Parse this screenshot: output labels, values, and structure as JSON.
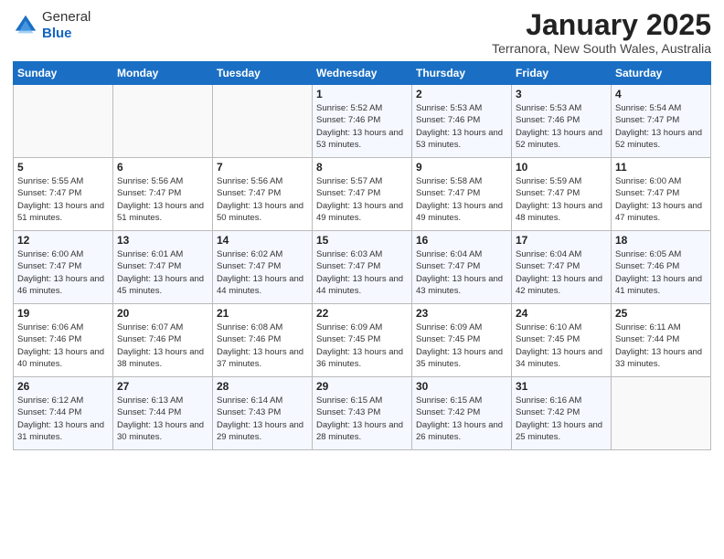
{
  "logo": {
    "general": "General",
    "blue": "Blue"
  },
  "header": {
    "title": "January 2025",
    "location": "Terranora, New South Wales, Australia"
  },
  "days_of_week": [
    "Sunday",
    "Monday",
    "Tuesday",
    "Wednesday",
    "Thursday",
    "Friday",
    "Saturday"
  ],
  "weeks": [
    [
      {
        "day": "",
        "info": ""
      },
      {
        "day": "",
        "info": ""
      },
      {
        "day": "",
        "info": ""
      },
      {
        "day": "1",
        "info": "Sunrise: 5:52 AM\nSunset: 7:46 PM\nDaylight: 13 hours\nand 53 minutes."
      },
      {
        "day": "2",
        "info": "Sunrise: 5:53 AM\nSunset: 7:46 PM\nDaylight: 13 hours\nand 53 minutes."
      },
      {
        "day": "3",
        "info": "Sunrise: 5:53 AM\nSunset: 7:46 PM\nDaylight: 13 hours\nand 52 minutes."
      },
      {
        "day": "4",
        "info": "Sunrise: 5:54 AM\nSunset: 7:47 PM\nDaylight: 13 hours\nand 52 minutes."
      }
    ],
    [
      {
        "day": "5",
        "info": "Sunrise: 5:55 AM\nSunset: 7:47 PM\nDaylight: 13 hours\nand 51 minutes."
      },
      {
        "day": "6",
        "info": "Sunrise: 5:56 AM\nSunset: 7:47 PM\nDaylight: 13 hours\nand 51 minutes."
      },
      {
        "day": "7",
        "info": "Sunrise: 5:56 AM\nSunset: 7:47 PM\nDaylight: 13 hours\nand 50 minutes."
      },
      {
        "day": "8",
        "info": "Sunrise: 5:57 AM\nSunset: 7:47 PM\nDaylight: 13 hours\nand 49 minutes."
      },
      {
        "day": "9",
        "info": "Sunrise: 5:58 AM\nSunset: 7:47 PM\nDaylight: 13 hours\nand 49 minutes."
      },
      {
        "day": "10",
        "info": "Sunrise: 5:59 AM\nSunset: 7:47 PM\nDaylight: 13 hours\nand 48 minutes."
      },
      {
        "day": "11",
        "info": "Sunrise: 6:00 AM\nSunset: 7:47 PM\nDaylight: 13 hours\nand 47 minutes."
      }
    ],
    [
      {
        "day": "12",
        "info": "Sunrise: 6:00 AM\nSunset: 7:47 PM\nDaylight: 13 hours\nand 46 minutes."
      },
      {
        "day": "13",
        "info": "Sunrise: 6:01 AM\nSunset: 7:47 PM\nDaylight: 13 hours\nand 45 minutes."
      },
      {
        "day": "14",
        "info": "Sunrise: 6:02 AM\nSunset: 7:47 PM\nDaylight: 13 hours\nand 44 minutes."
      },
      {
        "day": "15",
        "info": "Sunrise: 6:03 AM\nSunset: 7:47 PM\nDaylight: 13 hours\nand 44 minutes."
      },
      {
        "day": "16",
        "info": "Sunrise: 6:04 AM\nSunset: 7:47 PM\nDaylight: 13 hours\nand 43 minutes."
      },
      {
        "day": "17",
        "info": "Sunrise: 6:04 AM\nSunset: 7:47 PM\nDaylight: 13 hours\nand 42 minutes."
      },
      {
        "day": "18",
        "info": "Sunrise: 6:05 AM\nSunset: 7:46 PM\nDaylight: 13 hours\nand 41 minutes."
      }
    ],
    [
      {
        "day": "19",
        "info": "Sunrise: 6:06 AM\nSunset: 7:46 PM\nDaylight: 13 hours\nand 40 minutes."
      },
      {
        "day": "20",
        "info": "Sunrise: 6:07 AM\nSunset: 7:46 PM\nDaylight: 13 hours\nand 38 minutes."
      },
      {
        "day": "21",
        "info": "Sunrise: 6:08 AM\nSunset: 7:46 PM\nDaylight: 13 hours\nand 37 minutes."
      },
      {
        "day": "22",
        "info": "Sunrise: 6:09 AM\nSunset: 7:45 PM\nDaylight: 13 hours\nand 36 minutes."
      },
      {
        "day": "23",
        "info": "Sunrise: 6:09 AM\nSunset: 7:45 PM\nDaylight: 13 hours\nand 35 minutes."
      },
      {
        "day": "24",
        "info": "Sunrise: 6:10 AM\nSunset: 7:45 PM\nDaylight: 13 hours\nand 34 minutes."
      },
      {
        "day": "25",
        "info": "Sunrise: 6:11 AM\nSunset: 7:44 PM\nDaylight: 13 hours\nand 33 minutes."
      }
    ],
    [
      {
        "day": "26",
        "info": "Sunrise: 6:12 AM\nSunset: 7:44 PM\nDaylight: 13 hours\nand 31 minutes."
      },
      {
        "day": "27",
        "info": "Sunrise: 6:13 AM\nSunset: 7:44 PM\nDaylight: 13 hours\nand 30 minutes."
      },
      {
        "day": "28",
        "info": "Sunrise: 6:14 AM\nSunset: 7:43 PM\nDaylight: 13 hours\nand 29 minutes."
      },
      {
        "day": "29",
        "info": "Sunrise: 6:15 AM\nSunset: 7:43 PM\nDaylight: 13 hours\nand 28 minutes."
      },
      {
        "day": "30",
        "info": "Sunrise: 6:15 AM\nSunset: 7:42 PM\nDaylight: 13 hours\nand 26 minutes."
      },
      {
        "day": "31",
        "info": "Sunrise: 6:16 AM\nSunset: 7:42 PM\nDaylight: 13 hours\nand 25 minutes."
      },
      {
        "day": "",
        "info": ""
      }
    ]
  ]
}
